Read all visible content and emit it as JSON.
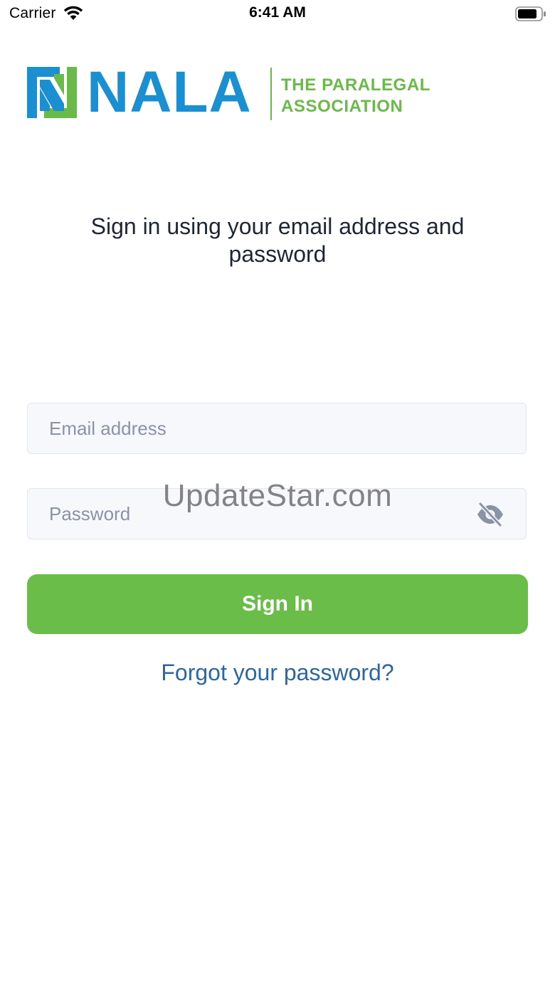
{
  "status_bar": {
    "carrier": "Carrier",
    "time": "6:41 AM"
  },
  "logo": {
    "wordmark": "NALA",
    "tagline_line1": "THE PARALEGAL",
    "tagline_line2": "ASSOCIATION",
    "colors": {
      "blue": "#1a8fd1",
      "green": "#6aba4a"
    }
  },
  "heading": "Sign in using your email address and password",
  "form": {
    "email_placeholder": "Email address",
    "password_placeholder": "Password",
    "password_toggle_icon": "eye-off-icon",
    "sign_in_label": "Sign In",
    "forgot_label": "Forgot your password?"
  },
  "watermark": "UpdateStar.com",
  "colors": {
    "button": "#6bbd4a",
    "link": "#2b67a4",
    "field_bg": "#f7f8fc"
  }
}
